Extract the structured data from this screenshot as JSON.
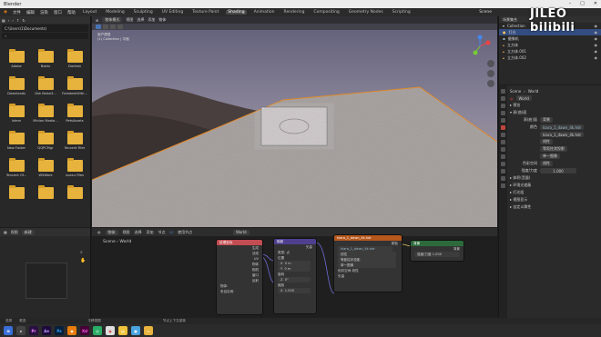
{
  "window": {
    "title": "Blender",
    "controls": [
      "–",
      "□",
      "✕"
    ]
  },
  "menubar": {
    "menus": [
      "文件",
      "编辑",
      "渲染",
      "窗口",
      "帮助"
    ],
    "workspaces": [
      "Layout",
      "Modeling",
      "Sculpting",
      "UV Editing",
      "Texture Paint",
      "Shading",
      "Animation",
      "Rendering",
      "Compositing",
      "Geometry Nodes",
      "Scripting"
    ],
    "active_workspace": "Shading",
    "scene": "Scene",
    "view_layer": "ViewLayer"
  },
  "watermark": {
    "text": "JILEO bilibili"
  },
  "file_browser": {
    "path": "C:\\Users\\1\\Documents\\",
    "folders": [
      "Adobe",
      "Baidu",
      "Darkest",
      "Downloads",
      "Dsk Baise3...",
      "FreedeskWith...",
      "Intern",
      "Minion Maste...",
      "PetsAssets",
      "New Folder",
      "QQPCMgr",
      "Tencent Files",
      "Tencent Of...",
      "WXWork",
      "xuexu Files",
      "",
      "",
      ""
    ]
  },
  "viewport": {
    "mode": "物体模式",
    "menus": [
      "视图",
      "选择",
      "添加",
      "物体"
    ],
    "info_line1": "用户透视",
    "info_line2": "(1) Collection | 平面"
  },
  "outliner": {
    "title": "场景集合",
    "items": [
      "Collection",
      "灯光",
      "摄像机",
      "立方体",
      "立方体.001",
      "立方体.002"
    ]
  },
  "properties": {
    "tabs_header": "Scene",
    "world_label": "World",
    "world_name": "World",
    "rows": [
      {
        "label": "▸ 预览",
        "value": ""
      },
      {
        "label": "▾ 表(曲)面",
        "value": ""
      },
      {
        "label": "表(曲)面",
        "value": "背景"
      },
      {
        "label": "颜色",
        "value": "kiara_1_dawn_4k.hdr"
      },
      {
        "label": "",
        "value": "kiara_1_dawn_4k.hdr"
      },
      {
        "label": "",
        "value": "线性"
      },
      {
        "label": "",
        "value": "等距柱状投影"
      },
      {
        "label": "",
        "value": "单一图像"
      },
      {
        "label": "色彩空间",
        "value": "线性"
      },
      {
        "label": "强度/力度",
        "value": "1.000"
      },
      {
        "label": "▸ 体积(音量)",
        "value": ""
      },
      {
        "label": "▸ 环境光遮蔽",
        "value": ""
      },
      {
        "label": "▸ 灯光组",
        "value": ""
      },
      {
        "label": "▸ 视图显示",
        "value": ""
      },
      {
        "label": "▸ 自定义属性",
        "value": ""
      }
    ]
  },
  "node_editor": {
    "header": [
      "物体",
      "视图",
      "选择",
      "添加",
      "节点",
      "使用节点"
    ],
    "world": "World",
    "breadcrumb_scene": "Scene",
    "breadcrumb_world": "World",
    "nodes": {
      "output": {
        "title": "世界输出",
        "rows": [
          "全部",
          "表(曲)面",
          "体积(音量)"
        ]
      },
      "mapping": {
        "title": "映射",
        "rows": [
          "矢量",
          "类型: 点",
          "位置",
          "旋转",
          "缩放"
        ]
      },
      "coord": {
        "title": "纹理坐标",
        "rows": [
          "生成",
          "法线",
          "UV",
          "物体",
          "相机",
          "窗口",
          "反射",
          "物体:",
          "来自实例"
        ]
      },
      "env": {
        "title": "kiara_1_dawn_4k.hdr",
        "rows": [
          "颜色",
          "线性",
          "等距柱状投影",
          "单一图像",
          "色彩空间  线性",
          "矢量"
        ]
      },
      "background": {
        "title": "背景",
        "rows": [
          "背景",
          "强度/力度  1.000"
        ]
      }
    }
  },
  "sidebar_bottom": {
    "view": "视图",
    "header": "新建"
  },
  "statusbar": {
    "items": [
      "选择",
      "框选",
      "平移视图",
      "节点上下文菜单"
    ]
  },
  "taskbar": {
    "apps": [
      "Windows",
      "Search",
      "Pr",
      "Ae",
      "Ps",
      "Blender",
      "Xd",
      "WeChat",
      "Chrome",
      "Notes",
      "Files",
      "Explorer"
    ]
  }
}
